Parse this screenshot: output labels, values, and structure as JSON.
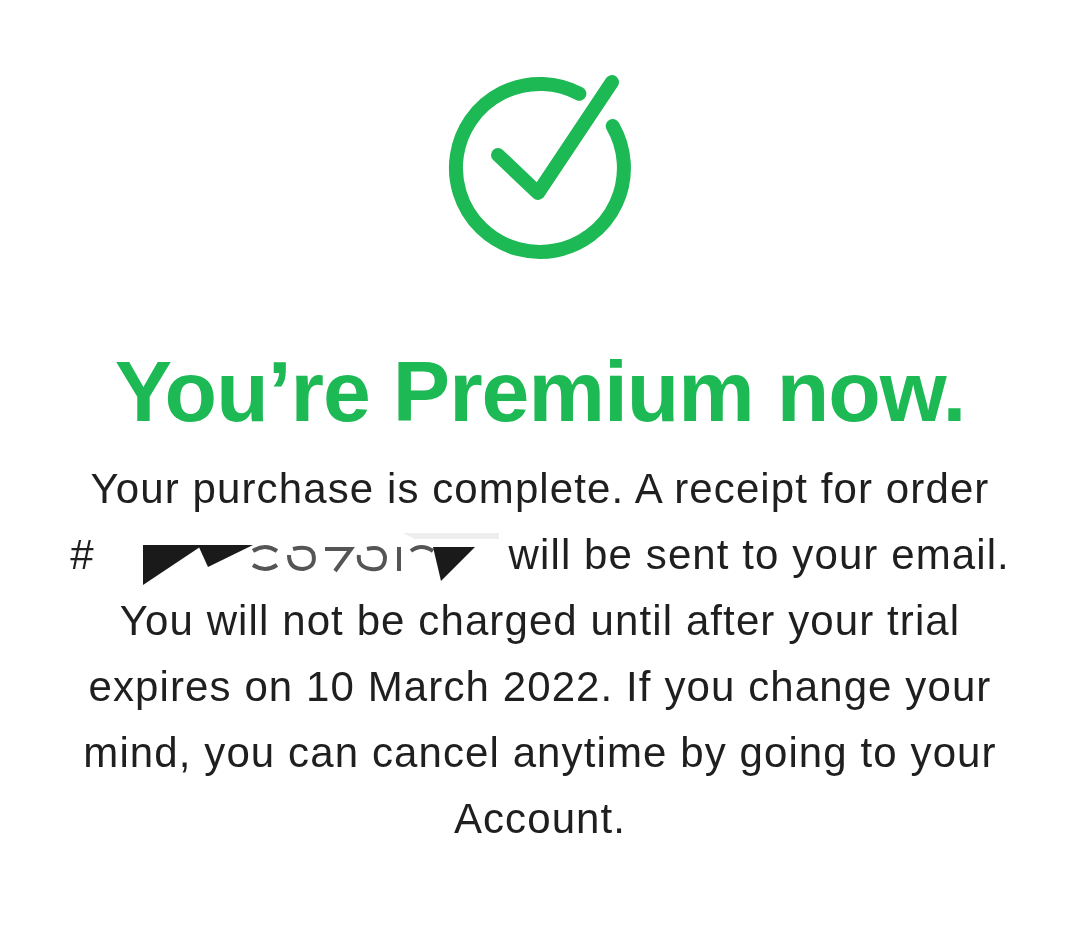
{
  "status_icon": {
    "kind": "check-circle"
  },
  "heading": "You’re Premium now.",
  "message": {
    "lead": "Your purchase is complete. A receipt for order",
    "order_prefix": "#",
    "redacted": true,
    "after": "will be sent to your email.",
    "note": "You will not be charged until after your trial expires on 10 March 2022. If you change your mind, you can cancel anytime by going to your Account."
  }
}
